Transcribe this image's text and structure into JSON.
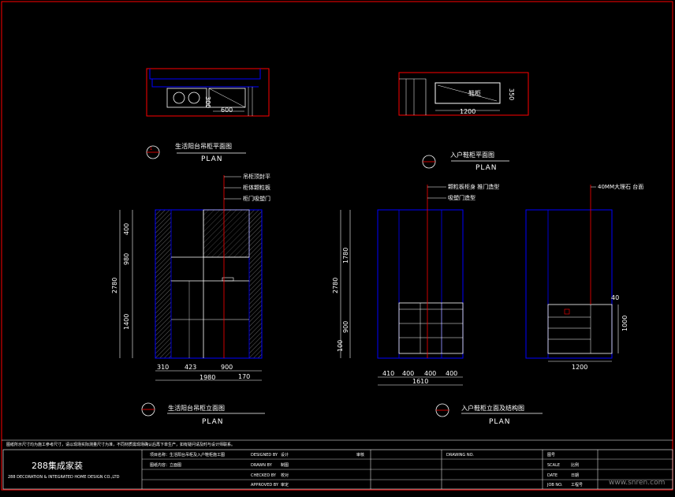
{
  "drawing": {
    "views": {
      "balcony_plan": {
        "title": "生活阳台吊柜平面图",
        "sub": "PLAN",
        "dims": {
          "depth": "300",
          "width": "600"
        }
      },
      "entry_plan": {
        "title": "入户鞋柜平面图",
        "sub": "PLAN",
        "dims": {
          "depth": "350",
          "width": "1200"
        },
        "text": "鞋柜"
      },
      "balcony_elev": {
        "title": "生活阳台吊柜立面图",
        "sub": "PLAN",
        "notes": [
          "吊柜顶封平",
          "柜体颗粒板",
          "柜门吸塑门"
        ],
        "vdims": [
          "400",
          "980",
          "1400",
          "2780"
        ],
        "hdims": [
          "310",
          "423",
          "900",
          "170",
          "1980"
        ]
      },
      "entry_elev": {
        "title": "入户鞋柜立面及结构图",
        "sub": "PLAN",
        "notes_left": [
          "颗粒板柜身 推门造型",
          "吸塑门造型"
        ],
        "notes_right": [
          "40MM大理石 台面"
        ],
        "vdims": [
          "1780",
          "900",
          "100",
          "2780"
        ],
        "hdims": [
          "410",
          "400",
          "400",
          "400",
          "1610"
        ],
        "right_dims": [
          "1000",
          "1200"
        ],
        "small_dim": "40"
      }
    },
    "title_block": {
      "note": "图纸所示尺寸均为施工参考尺寸，请以现场实际测量尺寸为准，不同材质需现场确认后再下单生产，如有疑问请及时与设计师联系。",
      "company": "288集成家装",
      "company_sub": "288 DECORATION & INTEGRATED HOME DESIGN CO.,LTD",
      "rows": [
        [
          "项目名称：生活阳台吊柜及入户鞋柜施工图",
          "DESIGNED BY",
          "设计",
          "审核",
          "DRAWING NO.",
          "图号"
        ],
        [
          "图纸内容：立面图",
          "DRAWN BY",
          "制图",
          "",
          "SCALE",
          "比例"
        ],
        [
          "",
          "CHECKED BY",
          "校对",
          "",
          "DATE",
          "日期"
        ],
        [
          "",
          "APPROVED BY",
          "审定",
          "",
          "JOB NO.",
          "工程号"
        ]
      ]
    },
    "watermark": "www.snren.com",
    "colors": {
      "red": "#ff0000",
      "blue": "#0000ff",
      "white": "#ffffff",
      "black": "#000000"
    }
  }
}
